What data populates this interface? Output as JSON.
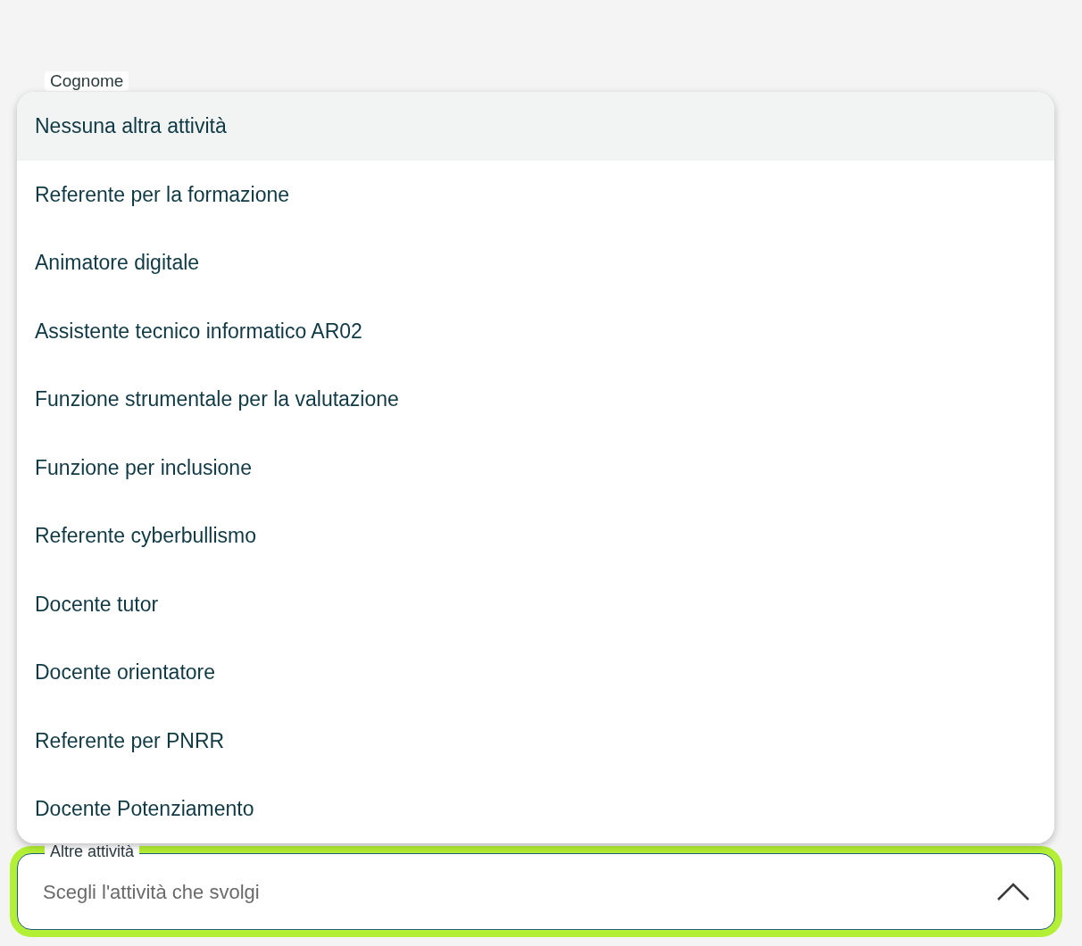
{
  "fields": [
    {
      "label": "Cognome"
    }
  ],
  "select": {
    "label": "Altre attività",
    "placeholder": "Scegli l'attività che svolgi",
    "expanded": true,
    "focused": true
  },
  "menu": {
    "options": [
      {
        "label": "Nessuna altra attività",
        "selected": true
      },
      {
        "label": "Referente per la formazione",
        "selected": false
      },
      {
        "label": "Animatore digitale",
        "selected": false
      },
      {
        "label": "Assistente tecnico informatico AR02",
        "selected": false
      },
      {
        "label": "Funzione strumentale per la valutazione",
        "selected": false
      },
      {
        "label": "Funzione per inclusione",
        "selected": false
      },
      {
        "label": "Referente cyberbullismo",
        "selected": false
      },
      {
        "label": "Docente tutor",
        "selected": false
      },
      {
        "label": "Docente orientatore",
        "selected": false
      },
      {
        "label": "Referente per PNRR",
        "selected": false
      },
      {
        "label": "Docente Potenziamento",
        "selected": false
      }
    ]
  }
}
